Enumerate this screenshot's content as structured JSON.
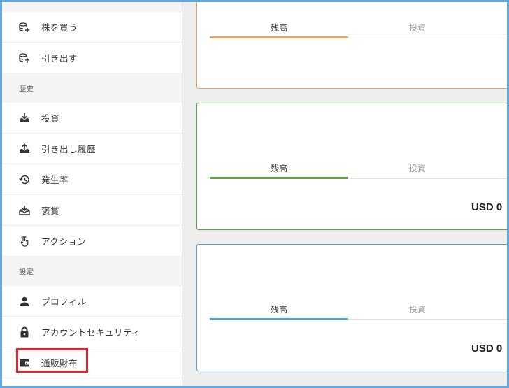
{
  "sidebar": {
    "items_top": [
      {
        "label": "株を買う",
        "icon": "database-plus-icon"
      },
      {
        "label": "引き出す",
        "icon": "database-arrow-icon"
      }
    ],
    "history_header": "歴史",
    "history_items": [
      {
        "label": "投資",
        "icon": "tray-download-icon"
      },
      {
        "label": "引き出し履歴",
        "icon": "tray-upload-icon"
      },
      {
        "label": "発生率",
        "icon": "history-icon"
      },
      {
        "label": "褒賞",
        "icon": "inbox-download-icon"
      },
      {
        "label": "アクション",
        "icon": "tap-hand-icon"
      }
    ],
    "settings_header": "設定",
    "settings_items": [
      {
        "label": "プロフィル",
        "icon": "user-icon"
      },
      {
        "label": "アカウントセキュリティ",
        "icon": "lock-icon"
      },
      {
        "label": "通販財布",
        "icon": "wallet-icon"
      }
    ]
  },
  "cards": [
    {
      "color": "#f0a061",
      "tabs": [
        "残高",
        "投資"
      ],
      "amount": ""
    },
    {
      "color": "#5aa041",
      "tabs": [
        "残高",
        "投資"
      ],
      "amount": "USD 0"
    },
    {
      "color": "#4ea5df",
      "tabs": [
        "残高",
        "投資"
      ],
      "amount": "USD 0"
    }
  ],
  "highlight_color": "#e0262c"
}
